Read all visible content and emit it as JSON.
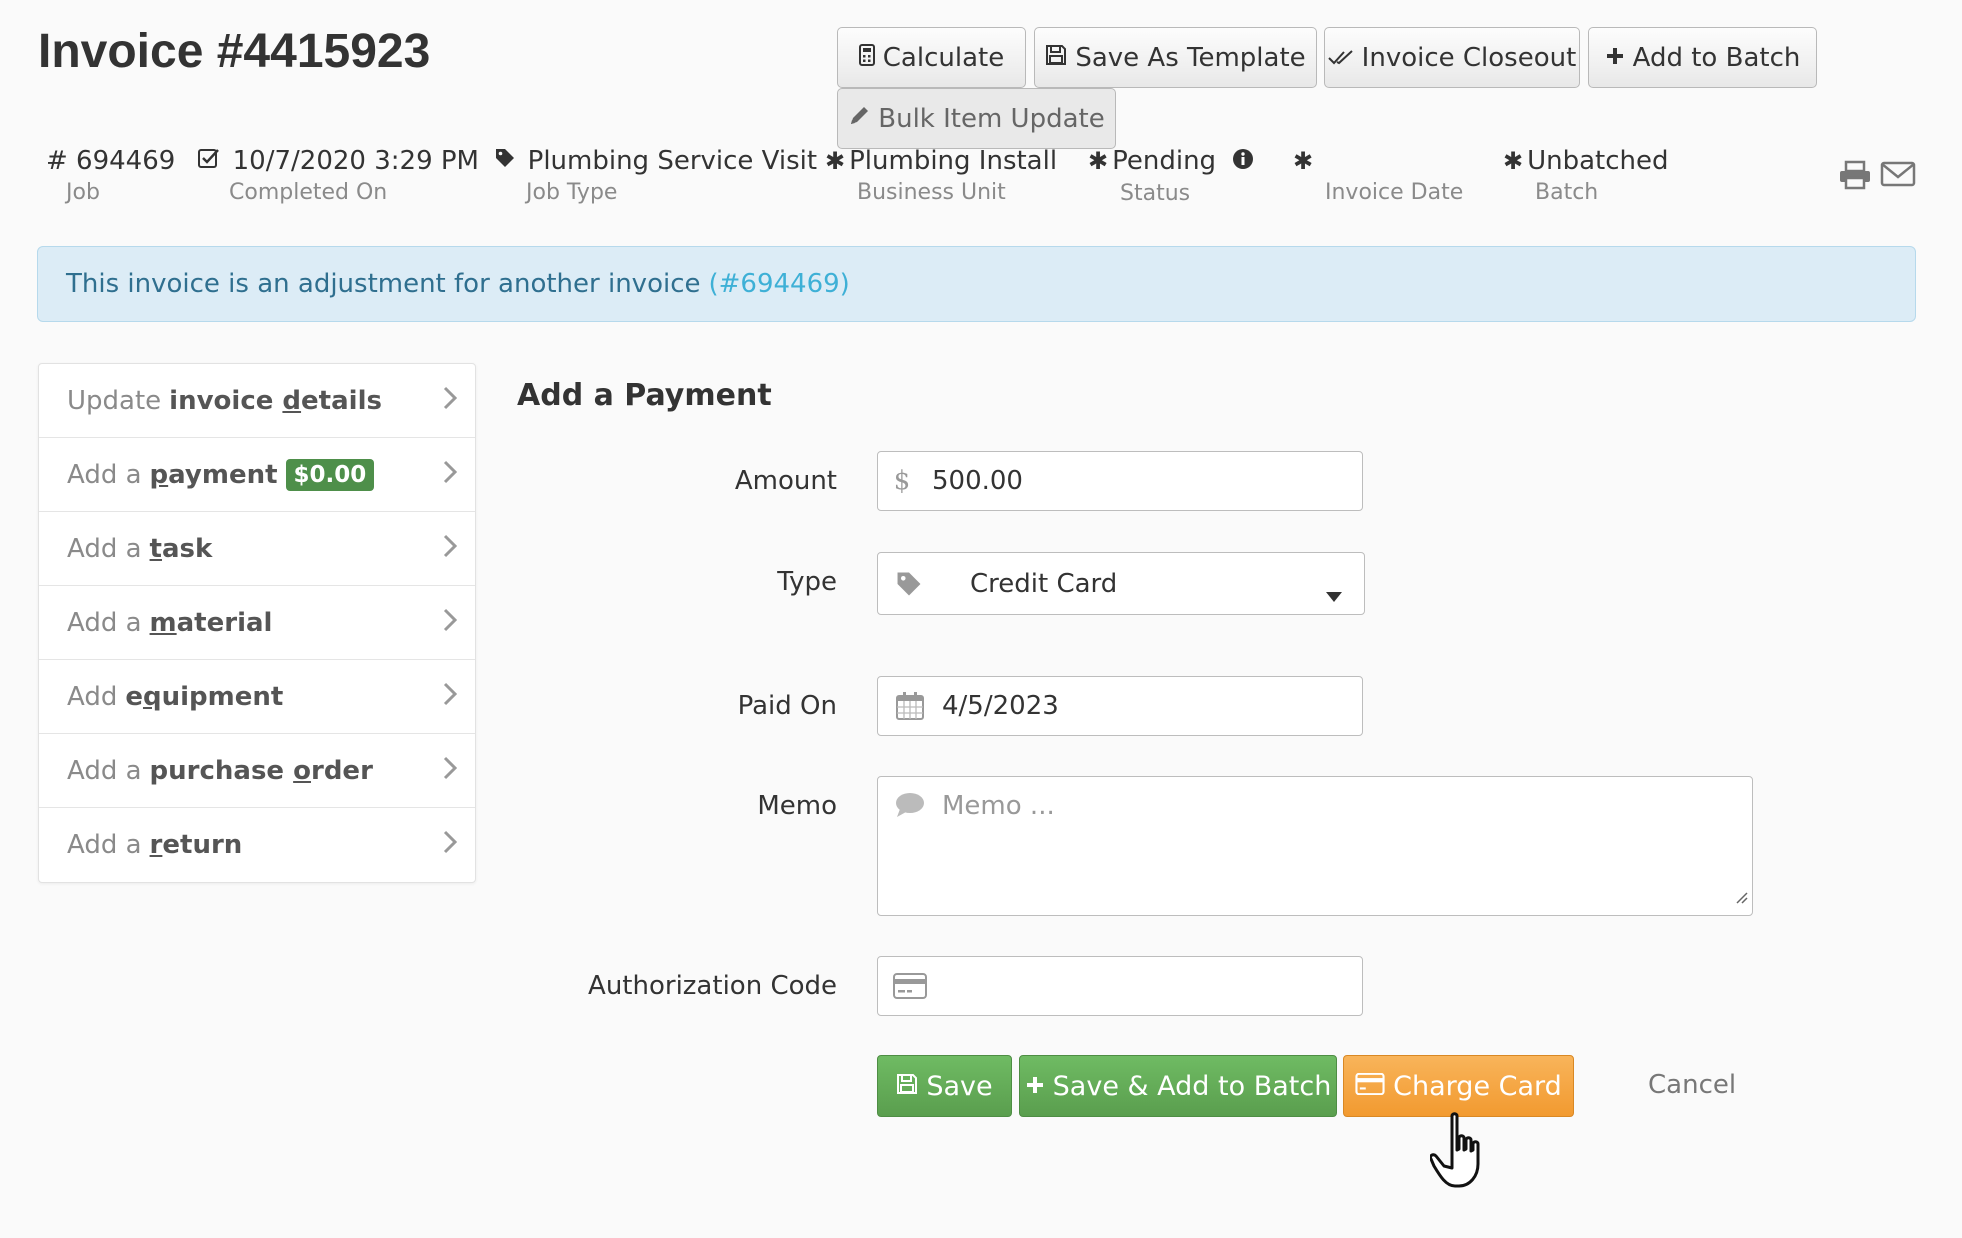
{
  "title": "Invoice #4415923",
  "toolbar": {
    "calculate": "Calculate",
    "save_template": "Save As Template",
    "closeout": "Invoice Closeout",
    "add_batch": "Add to Batch",
    "bulk_update": "Bulk Item Update"
  },
  "meta": {
    "job": {
      "value": "# 694469",
      "label": "Job"
    },
    "completed": {
      "value": "10/7/2020 3:29 PM",
      "label": "Completed On"
    },
    "job_type": {
      "value": "Plumbing Service Visit",
      "label": "Job Type"
    },
    "business_unit": {
      "value": "Plumbing Install",
      "label": "Business Unit"
    },
    "status": {
      "value": "Pending",
      "label": "Status"
    },
    "invoice_date": {
      "value": "",
      "label": "Invoice Date"
    },
    "batch": {
      "value": "Unbatched",
      "label": "Batch"
    }
  },
  "alert": {
    "text": "This invoice is an adjustment for another invoice",
    "link": "(#694469)"
  },
  "sidebar": {
    "items": [
      {
        "pre": "Update",
        "main_before": "invoice ",
        "underline": "d",
        "main_after": "etails"
      },
      {
        "pre": "Add a",
        "main_before": "",
        "underline": "p",
        "main_after": "ayment",
        "badge": "$0.00"
      },
      {
        "pre": "Add a",
        "main_before": "",
        "underline": "t",
        "main_after": "ask"
      },
      {
        "pre": "Add a",
        "main_before": "",
        "underline": "m",
        "main_after": "aterial"
      },
      {
        "pre": "Add",
        "main_before": "e",
        "underline": "q",
        "main_after": "uipment"
      },
      {
        "pre": "Add a",
        "main_before": "purchase ",
        "underline": "o",
        "main_after": "rder"
      },
      {
        "pre": "Add a",
        "main_before": "",
        "underline": "r",
        "main_after": "eturn"
      }
    ]
  },
  "form": {
    "section_title": "Add a Payment",
    "amount_label": "Amount",
    "amount_value": "500.00",
    "type_label": "Type",
    "type_value": "Credit Card",
    "paid_on_label": "Paid On",
    "paid_on_value": "4/5/2023",
    "memo_label": "Memo",
    "memo_placeholder": "Memo ...",
    "auth_label": "Authorization Code",
    "auth_value": ""
  },
  "actions": {
    "save": "Save",
    "save_batch": "Save & Add to Batch",
    "charge": "Charge Card",
    "cancel": "Cancel"
  },
  "colors": {
    "badge": "#4e8f4a",
    "save_green": "#5fa854",
    "charge_orange": "#f4a43f",
    "alert_bg": "#dcecf6",
    "link": "#3eb0d6"
  }
}
